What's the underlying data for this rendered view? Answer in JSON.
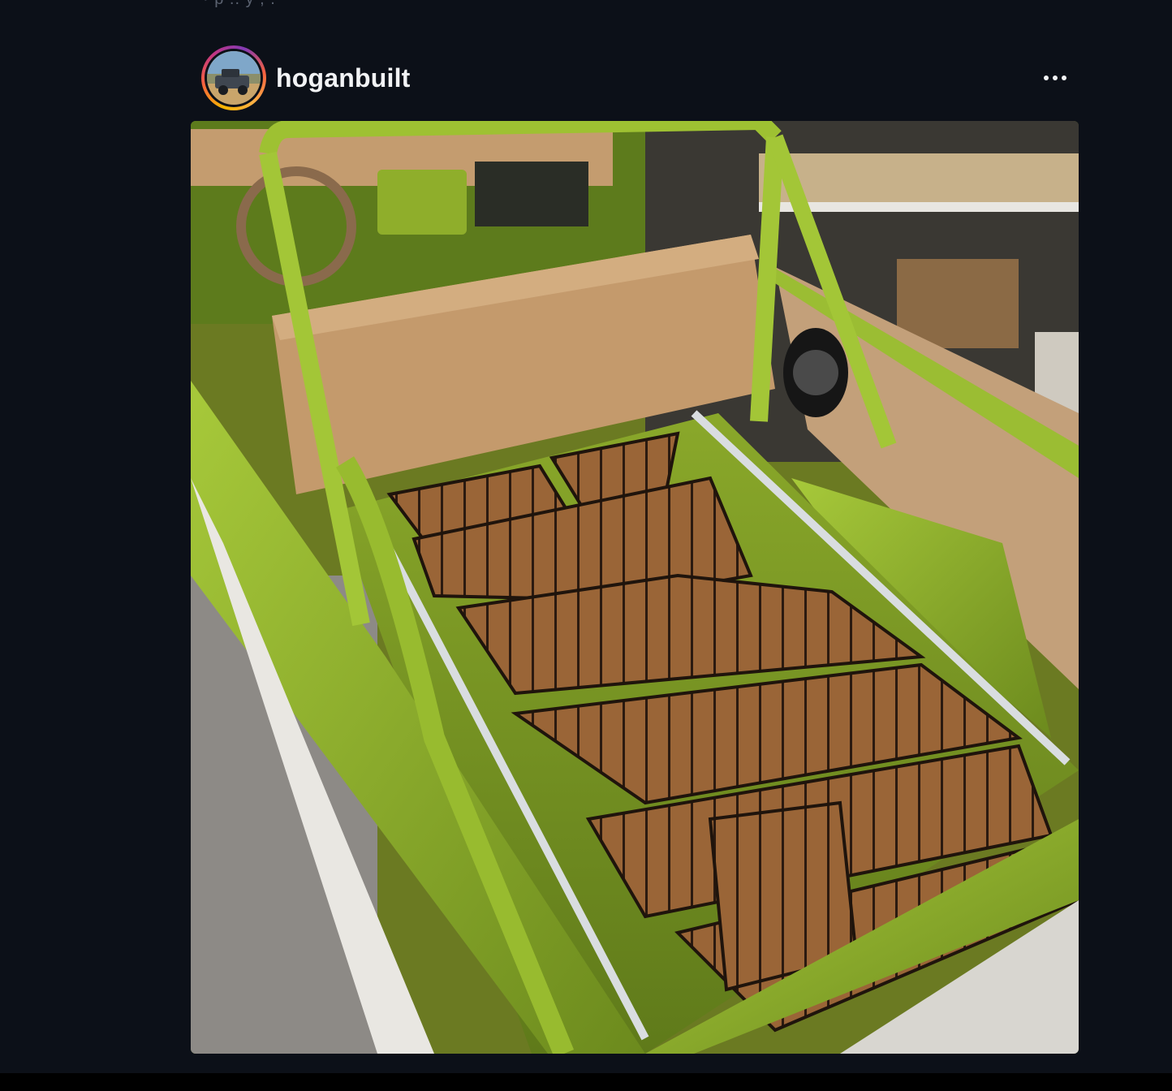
{
  "top_fragment": "· p .. y , .",
  "post": {
    "username": "hoganbuilt",
    "more_icon": "more-horizontal-icon",
    "image_description": "Truck bed with green roll bar, tan bench seat, and wood-grain mat flooring"
  },
  "colors": {
    "background": "#0c1018",
    "text": "#f2f3f5",
    "truck_green": "#8fb02a",
    "mat_brown": "#8b5a33"
  }
}
